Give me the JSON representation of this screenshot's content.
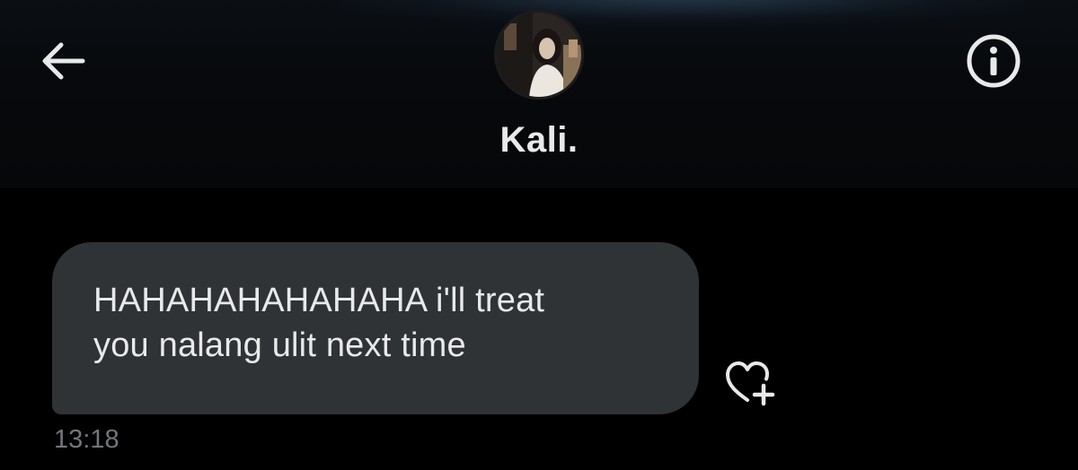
{
  "header": {
    "back_icon": "arrow-left-icon",
    "info_icon": "info-circle-icon",
    "contact_name": "Kali."
  },
  "conversation": {
    "messages": [
      {
        "text": "HAHAHAHAHAHAHA i'll treat\nyou nalang ulit next time",
        "time": "13:18",
        "react_icon": "heart-plus-icon"
      }
    ]
  },
  "colors": {
    "background": "#000000",
    "bubble": "#2f3336",
    "text": "#e7e9ea",
    "muted": "#71767b"
  }
}
